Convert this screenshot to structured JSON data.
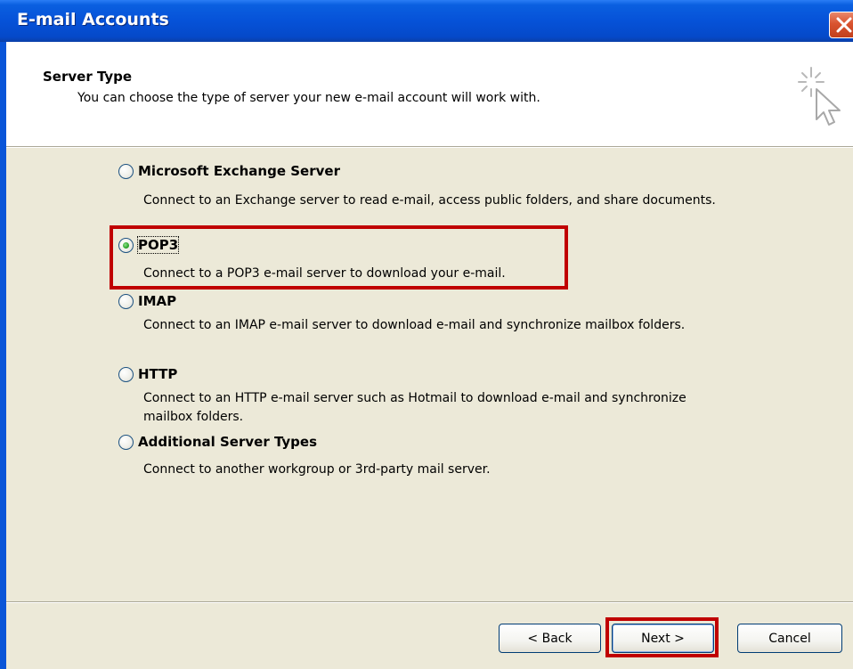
{
  "window": {
    "title": "E-mail Accounts",
    "close_label": "Close"
  },
  "header": {
    "title": "Server Type",
    "subtitle": "You can choose the type of server your new e-mail account will work with.",
    "icon": "wizard-cursor-icon"
  },
  "options": [
    {
      "label": "Microsoft Exchange Server",
      "description": "Connect to an Exchange server to read e-mail, access public folders, and share documents.",
      "selected": false
    },
    {
      "label": "POP3",
      "description": "Connect to a POP3 e-mail server to download your e-mail.",
      "selected": true
    },
    {
      "label": "IMAP",
      "description": "Connect to an IMAP e-mail server to download e-mail and synchronize mailbox folders.",
      "selected": false
    },
    {
      "label": "HTTP",
      "description": "Connect to an HTTP e-mail server such as Hotmail to download e-mail and synchronize mailbox folders.",
      "selected": false
    },
    {
      "label": "Additional Server Types",
      "description": "Connect to another workgroup or 3rd-party mail server.",
      "selected": false
    }
  ],
  "buttons": {
    "back": "< Back",
    "next": "Next >",
    "cancel": "Cancel"
  },
  "colors": {
    "title_bar": "#0652d8",
    "highlight": "#c00000",
    "dialog_bg": "#ECE9D8"
  }
}
